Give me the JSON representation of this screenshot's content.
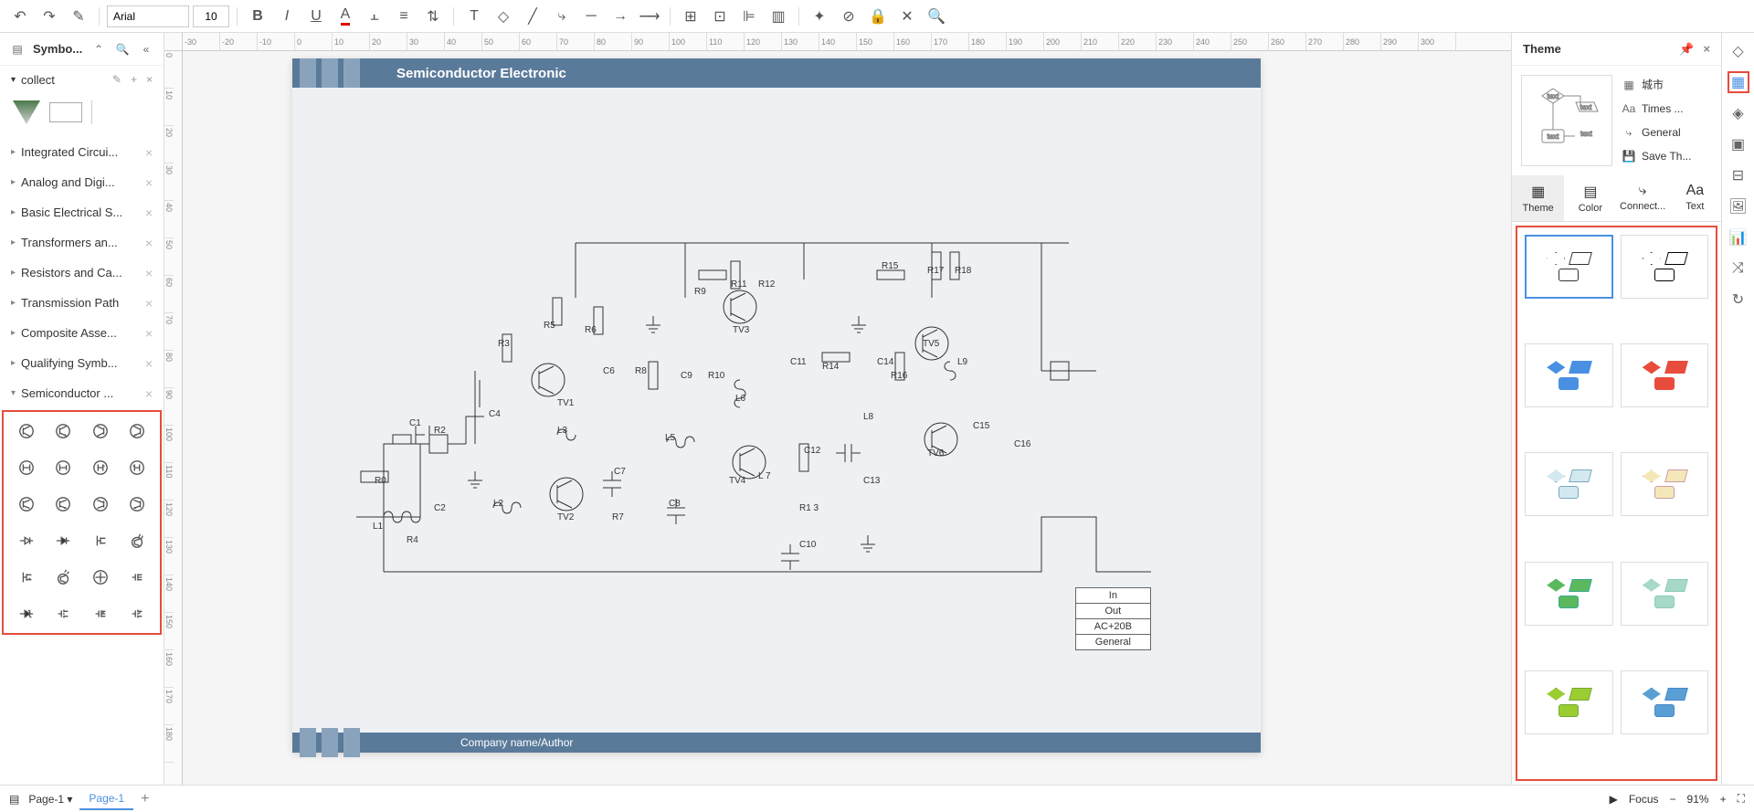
{
  "toolbar": {
    "font": "Arial",
    "size": "10"
  },
  "left": {
    "title": "Symbo...",
    "collect_label": "collect",
    "categories": [
      "Integrated Circui...",
      "Analog and Digi...",
      "Basic Electrical S...",
      "Transformers an...",
      "Resistors and Ca...",
      "Transmission Path",
      "Composite Asse...",
      "Qualifying Symb...",
      "Semiconductor ..."
    ]
  },
  "page": {
    "title": "Semiconductor Electronic",
    "footer": "Company name/Author",
    "labels": {
      "R0": "R0",
      "R1": "R1 3",
      "R2": "R2",
      "R3": "R3",
      "R4": "R4",
      "R5": "R5",
      "R6": "R6",
      "R7": "R7",
      "R8": "R8",
      "R9": "R9",
      "R10": "R10",
      "R11": "R11",
      "R12": "R12",
      "R14": "R14",
      "R15": "R15",
      "R16": "R16",
      "R17": "R17",
      "R18": "R18",
      "C1": "C1",
      "C2": "C2",
      "C4": "C4",
      "C6": "C6",
      "C7": "C7",
      "C8": "C8",
      "C9": "C9",
      "C10": "C10",
      "C11": "C11",
      "C12": "C12",
      "C13": "C13",
      "C14": "C14",
      "C15": "C15",
      "C16": "C16",
      "L1": "L1",
      "L2": "L2",
      "L3": "L3",
      "L5": "L5",
      "L6": "L6",
      "L7": "L 7",
      "L8": "L8",
      "L9": "L9",
      "TV1": "TV1",
      "TV2": "TV2",
      "TV3": "TV3",
      "TV4": "TV4",
      "TV5": "TV5",
      "TV6": "TV6"
    },
    "info": {
      "in": "In",
      "out": "Out",
      "ac": "AC+20B",
      "gen": "General"
    }
  },
  "right": {
    "title": "Theme",
    "opts": {
      "city": "城市",
      "font": "Times ...",
      "general": "General",
      "save": "Save Th..."
    },
    "tabs": {
      "theme": "Theme",
      "color": "Color",
      "connect": "Connect...",
      "text": "Text"
    },
    "preview": {
      "t1": "text",
      "t2": "text",
      "t3": "text",
      "t4": "text"
    },
    "themes": [
      {
        "c": "#fff",
        "s": "#333"
      },
      {
        "c": "#fff",
        "s": "#000"
      },
      {
        "c": "#4a90e2",
        "s": "#4a90e2"
      },
      {
        "c": "#e74c3c",
        "s": "#e74c3c"
      },
      {
        "c": "#d4e8f0",
        "s": "#7ab"
      },
      {
        "c": "#f5e8b8",
        "s": "#c9a"
      },
      {
        "c": "#5cb85c",
        "s": "#3a9"
      },
      {
        "c": "#a8d8c8",
        "s": "#8cb"
      },
      {
        "c": "#9acd32",
        "s": "#7a3"
      },
      {
        "c": "#5a9fd4",
        "s": "#48c"
      }
    ]
  },
  "status": {
    "page_sel": "Page-1",
    "page_tab": "Page-1",
    "focus": "Focus",
    "zoom": "91%"
  }
}
